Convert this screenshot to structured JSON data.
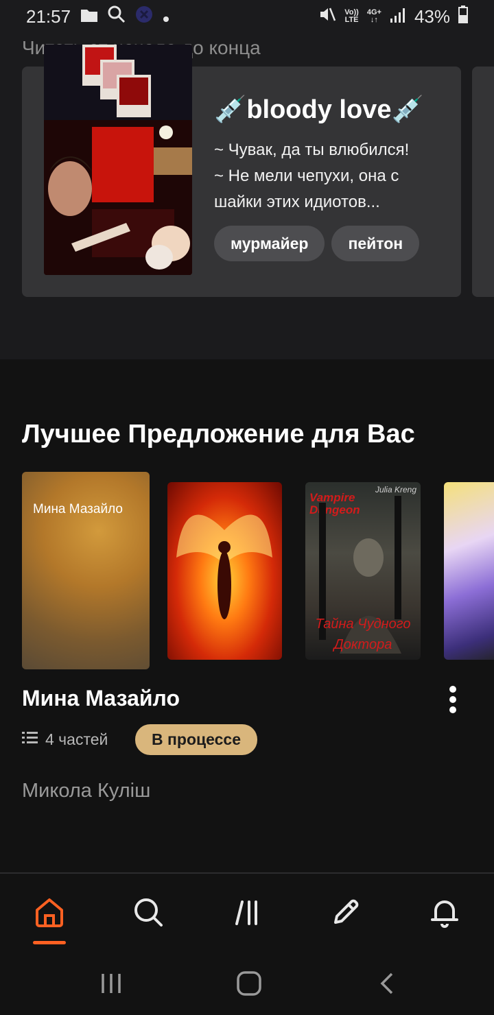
{
  "status_bar": {
    "time": "21:57",
    "net_top": "Vo))",
    "net_bottom": "LTE",
    "gen_top": "4G+",
    "gen_bottom": "↓↑",
    "battery": "43%"
  },
  "continue_reading": {
    "title": "Читать от начала до конца",
    "story": {
      "title": "💉bloody love💉",
      "description": "~ Чувак, да ты влюбился!\n~ Не мели чепухи, она с шайки этих идиотов...",
      "tags": [
        "мурмайер",
        "пейтон"
      ]
    }
  },
  "recommendations": {
    "title": "Лучшее Предложение для Вас",
    "covers": [
      {
        "text": "Мина Мазайло"
      },
      {
        "text": ""
      },
      {
        "top_text": "Vampire Dungeon",
        "author_text": "Julia Kreng",
        "bottom_text": "Тайна Чудного Доктора"
      },
      {
        "text": ""
      }
    ],
    "featured": {
      "title": "Мина Мазайло",
      "parts": "4 частей",
      "status": "В процессе",
      "author": "Микола Куліш"
    }
  },
  "nav": {
    "active": "home",
    "accent_color": "#ff6122",
    "items": [
      "home-icon",
      "search-icon",
      "library-icon",
      "write-icon",
      "notifications-icon"
    ]
  },
  "colors": {
    "background": "#121212",
    "card": "#343436",
    "status_badge": "#d9b67c"
  }
}
